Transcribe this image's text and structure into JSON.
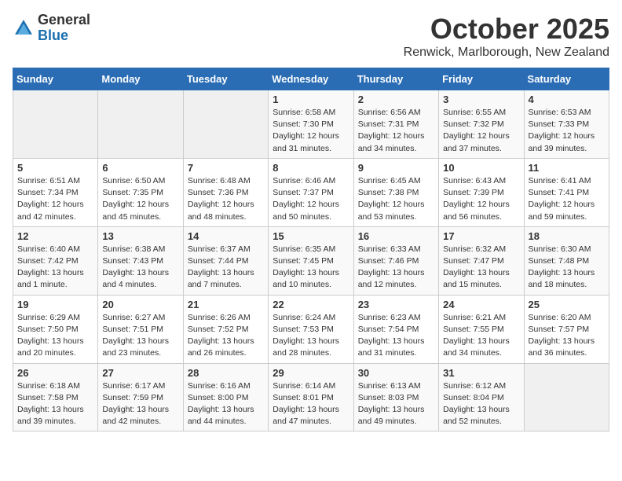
{
  "header": {
    "logo_general": "General",
    "logo_blue": "Blue",
    "title": "October 2025",
    "subtitle": "Renwick, Marlborough, New Zealand"
  },
  "days_of_week": [
    "Sunday",
    "Monday",
    "Tuesday",
    "Wednesday",
    "Thursday",
    "Friday",
    "Saturday"
  ],
  "weeks": [
    [
      {
        "day": "",
        "info": ""
      },
      {
        "day": "",
        "info": ""
      },
      {
        "day": "",
        "info": ""
      },
      {
        "day": "1",
        "info": "Sunrise: 6:58 AM\nSunset: 7:30 PM\nDaylight: 12 hours\nand 31 minutes."
      },
      {
        "day": "2",
        "info": "Sunrise: 6:56 AM\nSunset: 7:31 PM\nDaylight: 12 hours\nand 34 minutes."
      },
      {
        "day": "3",
        "info": "Sunrise: 6:55 AM\nSunset: 7:32 PM\nDaylight: 12 hours\nand 37 minutes."
      },
      {
        "day": "4",
        "info": "Sunrise: 6:53 AM\nSunset: 7:33 PM\nDaylight: 12 hours\nand 39 minutes."
      }
    ],
    [
      {
        "day": "5",
        "info": "Sunrise: 6:51 AM\nSunset: 7:34 PM\nDaylight: 12 hours\nand 42 minutes."
      },
      {
        "day": "6",
        "info": "Sunrise: 6:50 AM\nSunset: 7:35 PM\nDaylight: 12 hours\nand 45 minutes."
      },
      {
        "day": "7",
        "info": "Sunrise: 6:48 AM\nSunset: 7:36 PM\nDaylight: 12 hours\nand 48 minutes."
      },
      {
        "day": "8",
        "info": "Sunrise: 6:46 AM\nSunset: 7:37 PM\nDaylight: 12 hours\nand 50 minutes."
      },
      {
        "day": "9",
        "info": "Sunrise: 6:45 AM\nSunset: 7:38 PM\nDaylight: 12 hours\nand 53 minutes."
      },
      {
        "day": "10",
        "info": "Sunrise: 6:43 AM\nSunset: 7:39 PM\nDaylight: 12 hours\nand 56 minutes."
      },
      {
        "day": "11",
        "info": "Sunrise: 6:41 AM\nSunset: 7:41 PM\nDaylight: 12 hours\nand 59 minutes."
      }
    ],
    [
      {
        "day": "12",
        "info": "Sunrise: 6:40 AM\nSunset: 7:42 PM\nDaylight: 13 hours\nand 1 minute."
      },
      {
        "day": "13",
        "info": "Sunrise: 6:38 AM\nSunset: 7:43 PM\nDaylight: 13 hours\nand 4 minutes."
      },
      {
        "day": "14",
        "info": "Sunrise: 6:37 AM\nSunset: 7:44 PM\nDaylight: 13 hours\nand 7 minutes."
      },
      {
        "day": "15",
        "info": "Sunrise: 6:35 AM\nSunset: 7:45 PM\nDaylight: 13 hours\nand 10 minutes."
      },
      {
        "day": "16",
        "info": "Sunrise: 6:33 AM\nSunset: 7:46 PM\nDaylight: 13 hours\nand 12 minutes."
      },
      {
        "day": "17",
        "info": "Sunrise: 6:32 AM\nSunset: 7:47 PM\nDaylight: 13 hours\nand 15 minutes."
      },
      {
        "day": "18",
        "info": "Sunrise: 6:30 AM\nSunset: 7:48 PM\nDaylight: 13 hours\nand 18 minutes."
      }
    ],
    [
      {
        "day": "19",
        "info": "Sunrise: 6:29 AM\nSunset: 7:50 PM\nDaylight: 13 hours\nand 20 minutes."
      },
      {
        "day": "20",
        "info": "Sunrise: 6:27 AM\nSunset: 7:51 PM\nDaylight: 13 hours\nand 23 minutes."
      },
      {
        "day": "21",
        "info": "Sunrise: 6:26 AM\nSunset: 7:52 PM\nDaylight: 13 hours\nand 26 minutes."
      },
      {
        "day": "22",
        "info": "Sunrise: 6:24 AM\nSunset: 7:53 PM\nDaylight: 13 hours\nand 28 minutes."
      },
      {
        "day": "23",
        "info": "Sunrise: 6:23 AM\nSunset: 7:54 PM\nDaylight: 13 hours\nand 31 minutes."
      },
      {
        "day": "24",
        "info": "Sunrise: 6:21 AM\nSunset: 7:55 PM\nDaylight: 13 hours\nand 34 minutes."
      },
      {
        "day": "25",
        "info": "Sunrise: 6:20 AM\nSunset: 7:57 PM\nDaylight: 13 hours\nand 36 minutes."
      }
    ],
    [
      {
        "day": "26",
        "info": "Sunrise: 6:18 AM\nSunset: 7:58 PM\nDaylight: 13 hours\nand 39 minutes."
      },
      {
        "day": "27",
        "info": "Sunrise: 6:17 AM\nSunset: 7:59 PM\nDaylight: 13 hours\nand 42 minutes."
      },
      {
        "day": "28",
        "info": "Sunrise: 6:16 AM\nSunset: 8:00 PM\nDaylight: 13 hours\nand 44 minutes."
      },
      {
        "day": "29",
        "info": "Sunrise: 6:14 AM\nSunset: 8:01 PM\nDaylight: 13 hours\nand 47 minutes."
      },
      {
        "day": "30",
        "info": "Sunrise: 6:13 AM\nSunset: 8:03 PM\nDaylight: 13 hours\nand 49 minutes."
      },
      {
        "day": "31",
        "info": "Sunrise: 6:12 AM\nSunset: 8:04 PM\nDaylight: 13 hours\nand 52 minutes."
      },
      {
        "day": "",
        "info": ""
      }
    ]
  ]
}
